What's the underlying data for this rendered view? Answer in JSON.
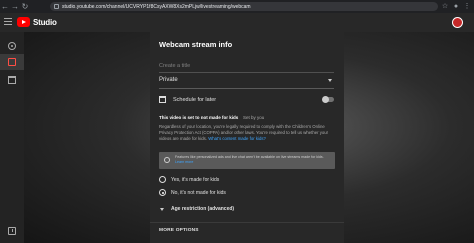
{
  "browser": {
    "url": "studio.youtube.com/channel/UCVRYP1f8CsyAXW8Xs2mPLjw/livestreaming/webcam"
  },
  "studio": {
    "brand": "Studio"
  },
  "rail": {
    "items": [
      {
        "icon": "live-stream-icon",
        "active": false
      },
      {
        "icon": "webcam-icon",
        "active": true
      },
      {
        "icon": "calendar-icon",
        "active": false
      },
      {
        "icon": "feedback-icon",
        "active": false
      }
    ]
  },
  "dialog": {
    "title": "Webcam stream info",
    "title_placeholder": "Create a title",
    "privacy_value": "Private",
    "schedule_label": "Schedule for later",
    "schedule_on": false,
    "kids_status": "This video is set to not made for kids",
    "kids_set_by": "Set by you",
    "coppa_text": "Regardless of your location, you're legally required to comply with the Children's Online Privacy Protection Act (COPPA) and/or other laws. You're required to tell us whether your videos are made for kids.",
    "coppa_link": "What's content made for kids?",
    "notice_text": "Features like personalized ads and live chat aren't be available on live streams made for kids.",
    "notice_link": "Learn more",
    "radio_yes": "Yes, it's made for kids",
    "radio_no": "No, it's not made for kids",
    "radio_selected": "no",
    "age_restriction": "Age restriction (advanced)",
    "more_options": "MORE OPTIONS"
  }
}
